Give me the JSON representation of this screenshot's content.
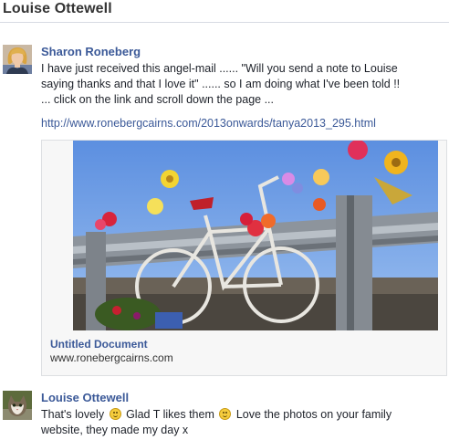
{
  "page": {
    "title": "Louise Ottewell"
  },
  "posts": [
    {
      "author": "Sharon Roneberg",
      "lines": [
        "I have just received this angel-mail ...... \"Will you send a note to Louise",
        "saying thanks and that I love it\" ...... so I am doing what I've been told !!",
        "... click on the link and scroll down the page ..."
      ],
      "link": "http://www.ronebergcairns.com/2013onwards/tanya2013_295.html",
      "share": {
        "title": "Untitled Document",
        "domain": "www.ronebergcairns.com"
      }
    },
    {
      "author": "Louise Ottewell",
      "line1_a": "That's lovely",
      "line1_b": "Glad T likes them",
      "line1_c": "Love the photos on your family",
      "line2": "website, they made my day x"
    }
  ],
  "icons": {
    "avatar_1": "avatar-photo-woman",
    "avatar_2": "avatar-photo-cat",
    "emoji": "smiley-face-icon"
  }
}
